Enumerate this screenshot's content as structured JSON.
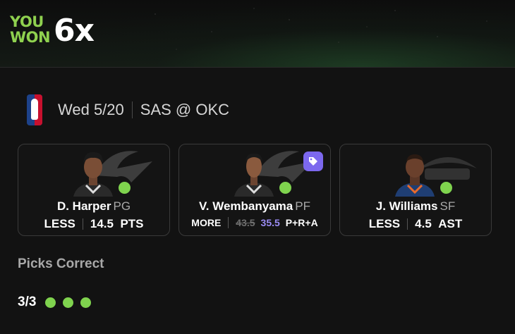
{
  "banner": {
    "you": "YOU",
    "won": "WON",
    "multiplier": "6x"
  },
  "game": {
    "league_icon": "nba-logo",
    "date": "Wed 5/20",
    "matchup": "SAS @ OKC"
  },
  "picks": [
    {
      "name": "D. Harper",
      "position": "PG",
      "direction": "LESS",
      "line": "14.5",
      "stat": "PTS",
      "result": "correct",
      "team_logo": "spurs-logo"
    },
    {
      "name": "V. Wembanyama",
      "position": "PF",
      "direction": "MORE",
      "original_line": "43.5",
      "line": "35.5",
      "stat": "P+R+A",
      "result": "correct",
      "team_logo": "spurs-logo",
      "badge": "promo-tag-icon"
    },
    {
      "name": "J. Williams",
      "position": "SF",
      "direction": "LESS",
      "line": "4.5",
      "stat": "AST",
      "result": "correct",
      "team_logo": "thunder-logo"
    }
  ],
  "summary": {
    "title": "Picks Correct",
    "count": "3/3",
    "results": [
      "correct",
      "correct",
      "correct"
    ]
  },
  "colors": {
    "accent_green": "#7fd34e",
    "promo_purple": "#7c68ee",
    "background": "#121212"
  }
}
